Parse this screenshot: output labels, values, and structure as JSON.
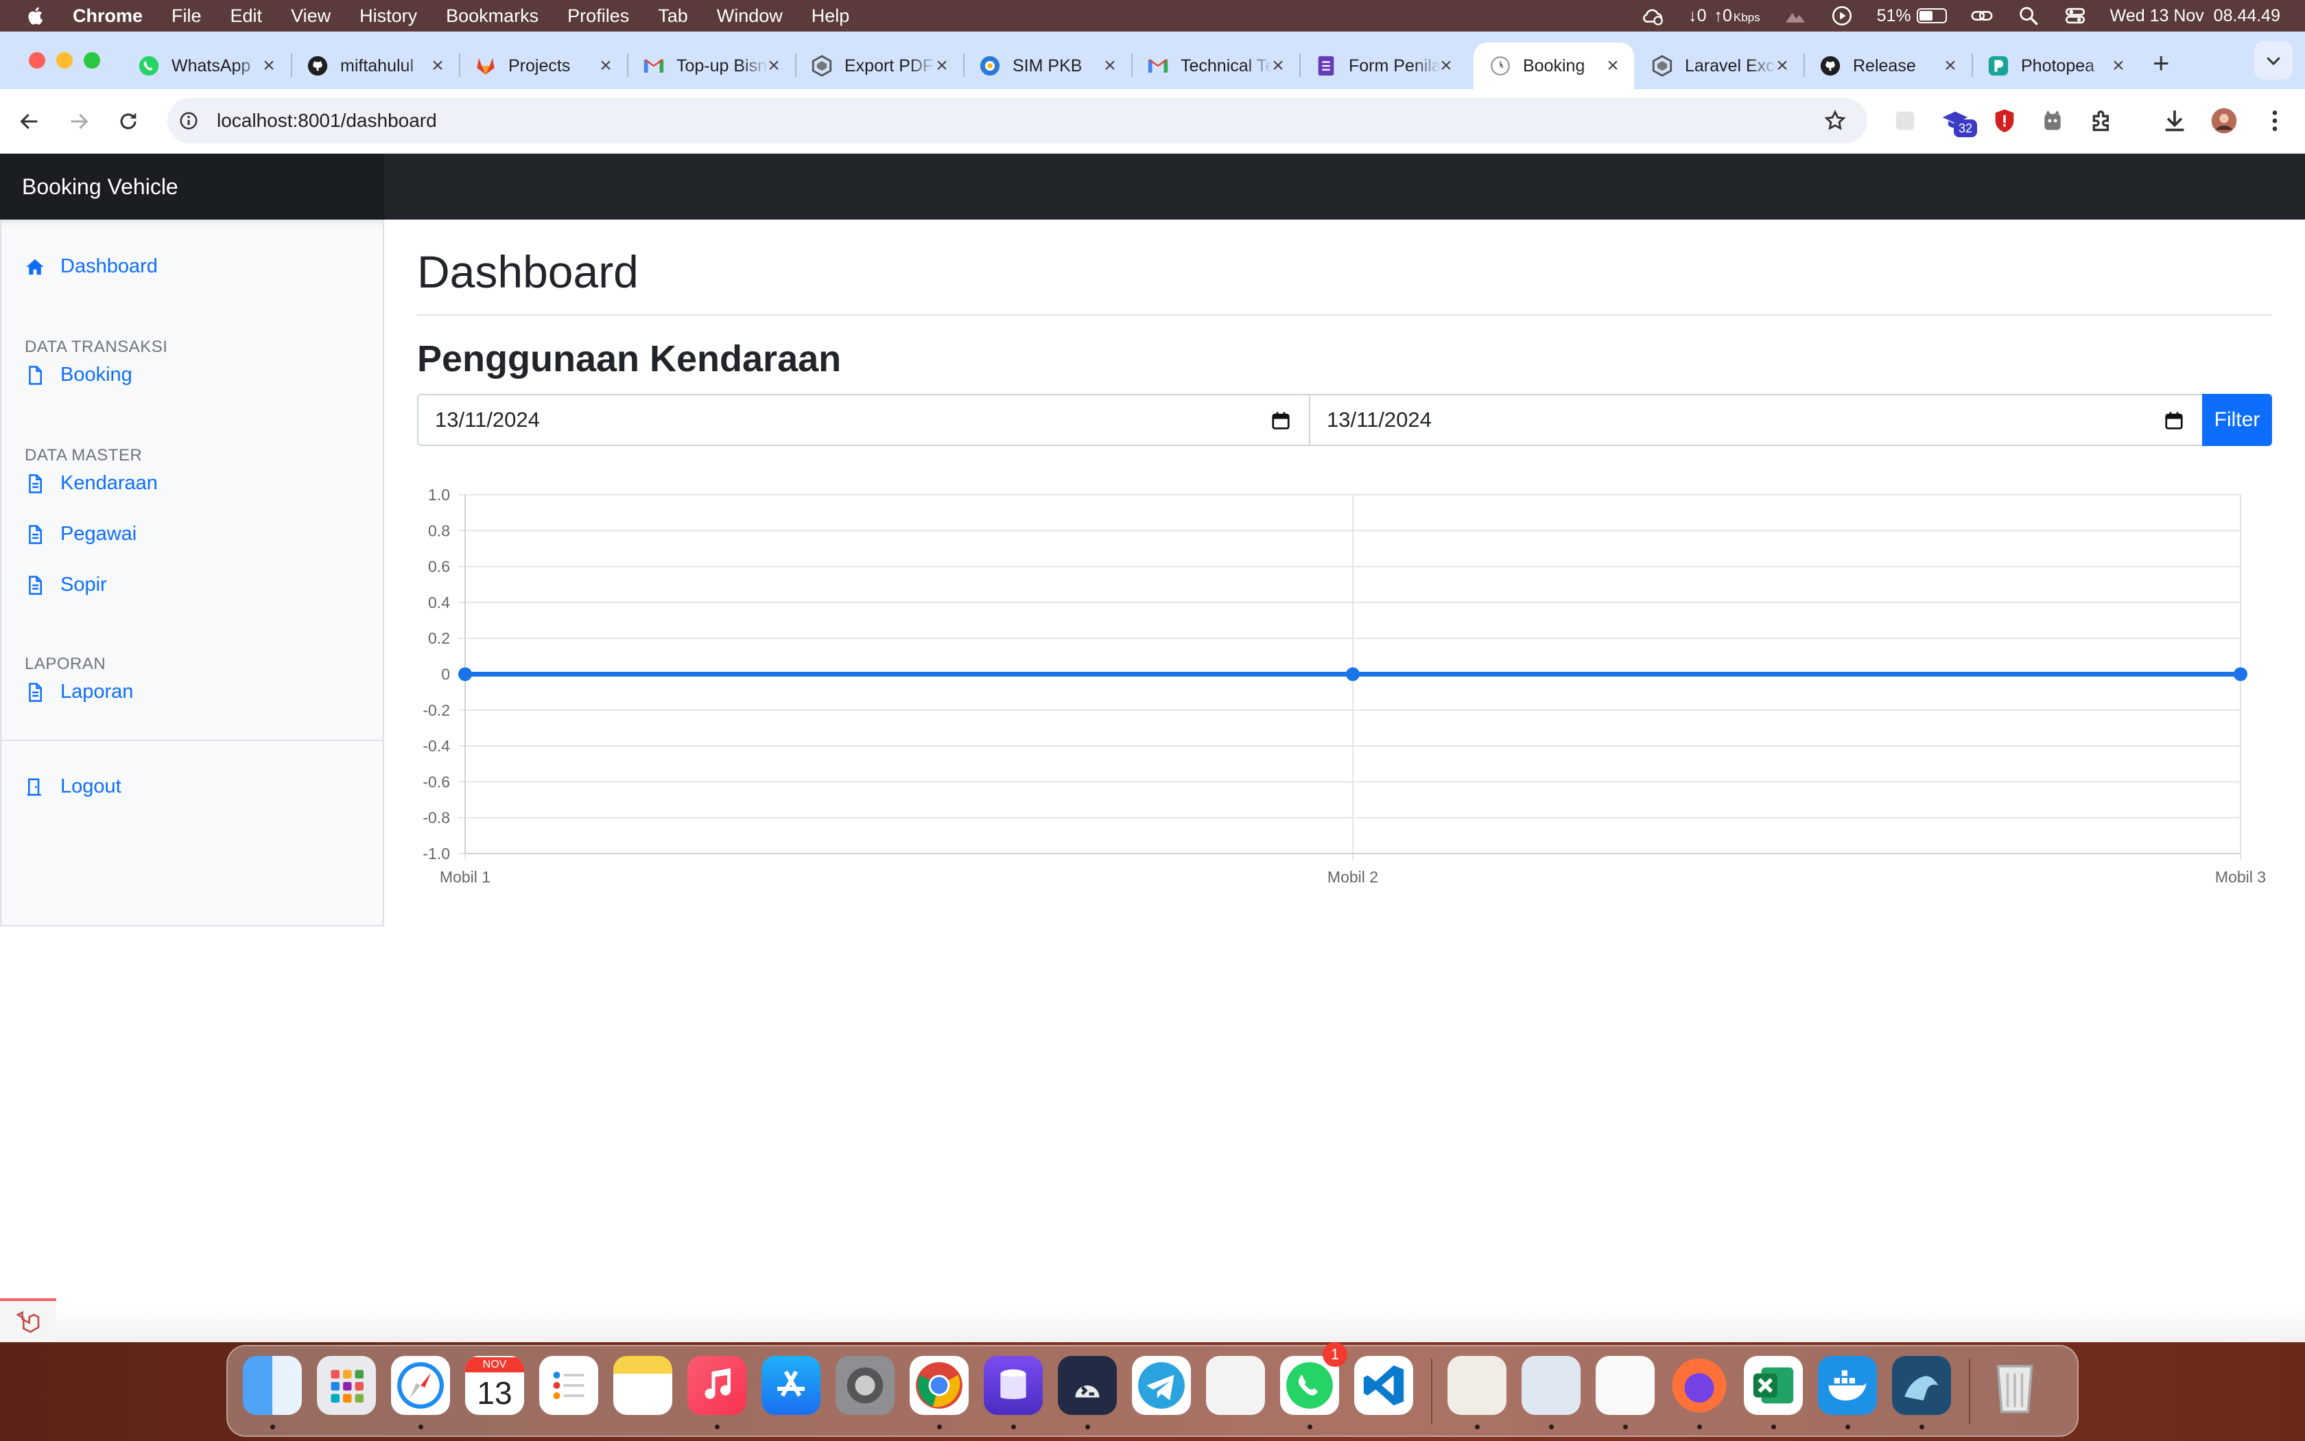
{
  "menubar": {
    "app_name": "Chrome",
    "items": [
      "File",
      "Edit",
      "View",
      "History",
      "Bookmarks",
      "Profiles",
      "Tab",
      "Window",
      "Help"
    ],
    "net_down": "↓0",
    "net_up": "↑0",
    "net_unit": "Kbps",
    "battery_percent": "51%",
    "battery_level": 0.51,
    "datetime": "Wed 13 Nov  08.44.49"
  },
  "browser": {
    "tabs": [
      {
        "title": "WhatsApp",
        "icon": "whatsapp-icon"
      },
      {
        "title": "miftahulul",
        "icon": "github-icon"
      },
      {
        "title": "Projects",
        "icon": "gitlab-icon"
      },
      {
        "title": "Top-up Bisnis",
        "icon": "gmail-icon"
      },
      {
        "title": "Export PDF",
        "icon": "laravel-icon"
      },
      {
        "title": "SIM PKB",
        "icon": "sim-icon"
      },
      {
        "title": "Technical Test",
        "icon": "gmail-icon"
      },
      {
        "title": "Form Penilaian",
        "icon": "forms-icon"
      },
      {
        "title": "Booking",
        "icon": "page-icon",
        "active": true
      },
      {
        "title": "Laravel Excel",
        "icon": "laravel-icon"
      },
      {
        "title": "Release",
        "icon": "github-icon"
      },
      {
        "title": "Photopea",
        "icon": "photopea-icon"
      }
    ],
    "url": "localhost:8001/dashboard",
    "extension_badge": "32"
  },
  "app": {
    "brand": "Booking Vehicle",
    "sidebar": {
      "dashboard": "Dashboard",
      "section_transaksi": "DATA TRANSAKSI",
      "booking": "Booking",
      "section_master": "DATA MASTER",
      "kendaraan": "Kendaraan",
      "pegawai": "Pegawai",
      "sopir": "Sopir",
      "section_laporan": "LAPORAN",
      "laporan": "Laporan",
      "logout": "Logout"
    },
    "page_title": "Dashboard",
    "section_title": "Penggunaan Kendaraan",
    "filter": {
      "start_date": "13/11/2024",
      "end_date": "13/11/2024",
      "button": "Filter"
    }
  },
  "chart_data": {
    "type": "line",
    "categories": [
      "Mobil 1",
      "Mobil 2",
      "Mobil 3"
    ],
    "series": [
      {
        "values": [
          0,
          0,
          0
        ],
        "color": "#1a73e8"
      }
    ],
    "ylim": [
      -1.0,
      1.0
    ],
    "yticks": [
      "1.0",
      "0.8",
      "0.6",
      "0.4",
      "0.2",
      "0",
      "-0.2",
      "-0.4",
      "-0.6",
      "-0.8",
      "-1.0"
    ],
    "grid": true,
    "legend": "none"
  },
  "dock": {
    "apps": [
      "finder-icon",
      "launchpad-icon",
      "safari-icon",
      "calendar-icon",
      "reminders-icon",
      "notes-icon",
      "music-icon",
      "app-store-icon",
      "system-settings-icon",
      "chrome-icon",
      "database-icon",
      "terminal-icon",
      "telegram-icon",
      "dog-app-icon",
      "whatsapp-icon",
      "vscode-icon",
      "sequel-icon",
      "preview-icon",
      "textedit-icon",
      "firefox-icon",
      "excel-icon",
      "docker-icon",
      "mysql-workbench-icon",
      "trash-icon"
    ],
    "calendar_month": "NOV",
    "calendar_day": "13",
    "whatsapp_badge": "1"
  }
}
